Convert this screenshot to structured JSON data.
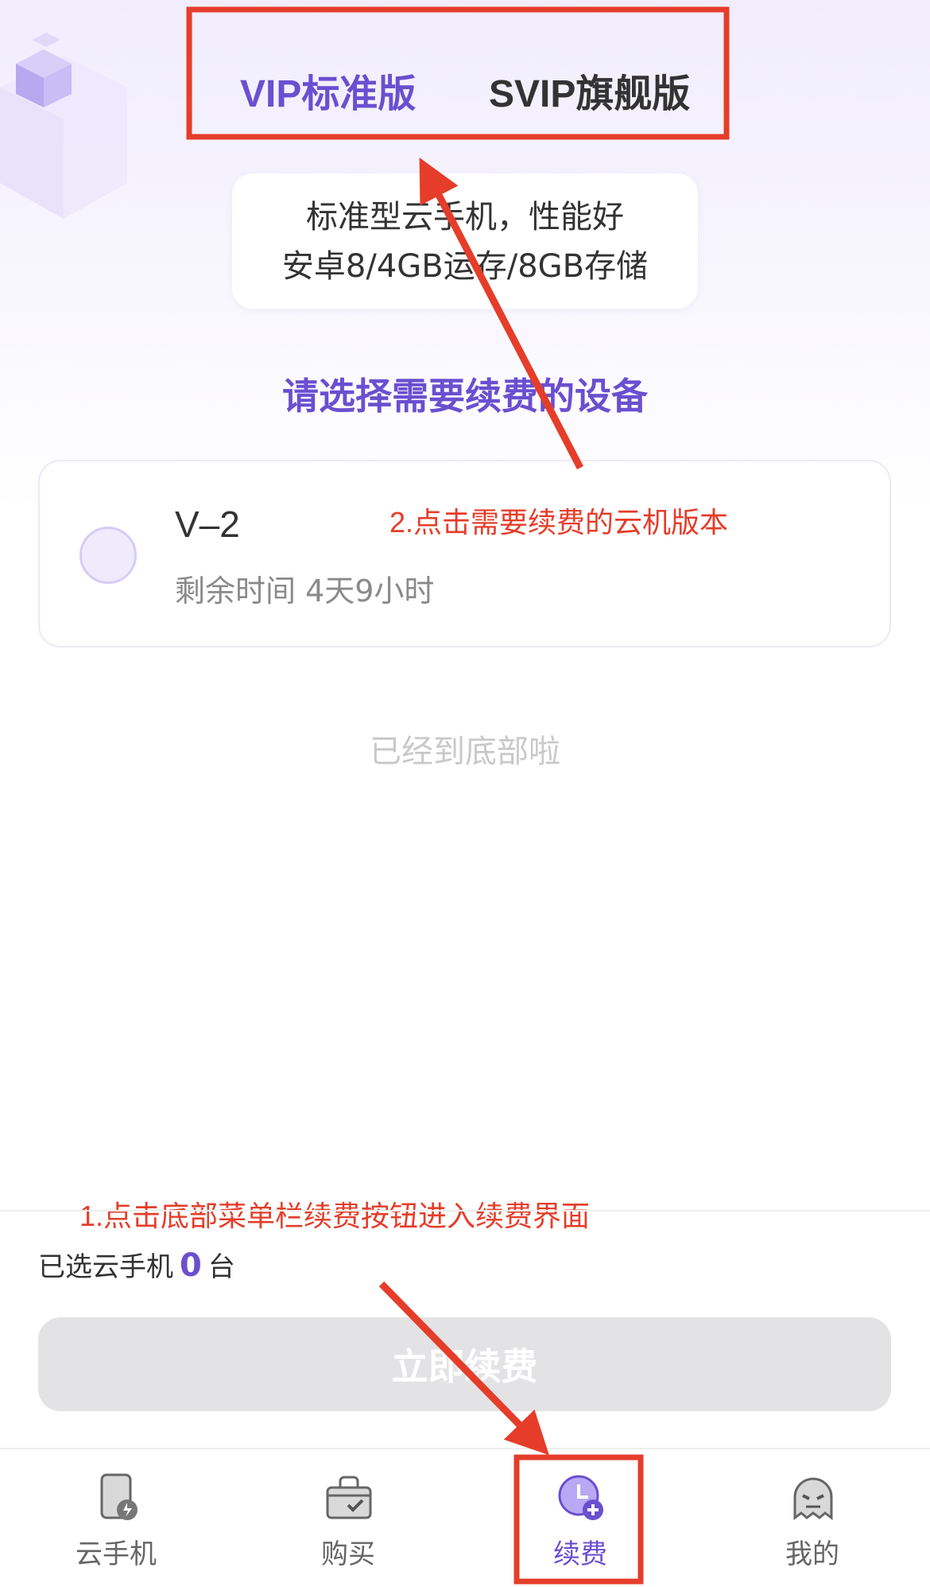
{
  "plans": {
    "tabs": [
      {
        "label": "VIP标准版",
        "active": true
      },
      {
        "label": "SVIP旗舰版",
        "active": false
      }
    ],
    "spec_lines": [
      "标准型云手机，性能好",
      "安卓8/4GB运存/8GB存储"
    ]
  },
  "section_title": "请选择需要续费的设备",
  "devices": [
    {
      "name": "V–2",
      "remaining": "剩余时间 4天9小时",
      "selected": false
    }
  ],
  "end_hint": "已经到底部啦",
  "footer": {
    "selected_prefix": "已选云手机",
    "selected_count": "0",
    "selected_suffix": "台",
    "renew_button": "立即续费"
  },
  "tabbar": {
    "items": [
      {
        "label": "云手机",
        "icon": "cloud-phone-icon",
        "active": false
      },
      {
        "label": "购买",
        "icon": "shopping-bag-icon",
        "active": false
      },
      {
        "label": "续费",
        "icon": "renew-clock-icon",
        "active": true
      },
      {
        "label": "我的",
        "icon": "ghost-avatar-icon",
        "active": false
      }
    ]
  },
  "annotations": {
    "step2": "2.点击需要续费的云机版本",
    "step1": "1.点击底部菜单栏续费按钮进入续费界面"
  },
  "colors": {
    "accent": "#6a4fd0",
    "annotation": "#e53d2a",
    "disabled_button": "#e3e3e6"
  }
}
